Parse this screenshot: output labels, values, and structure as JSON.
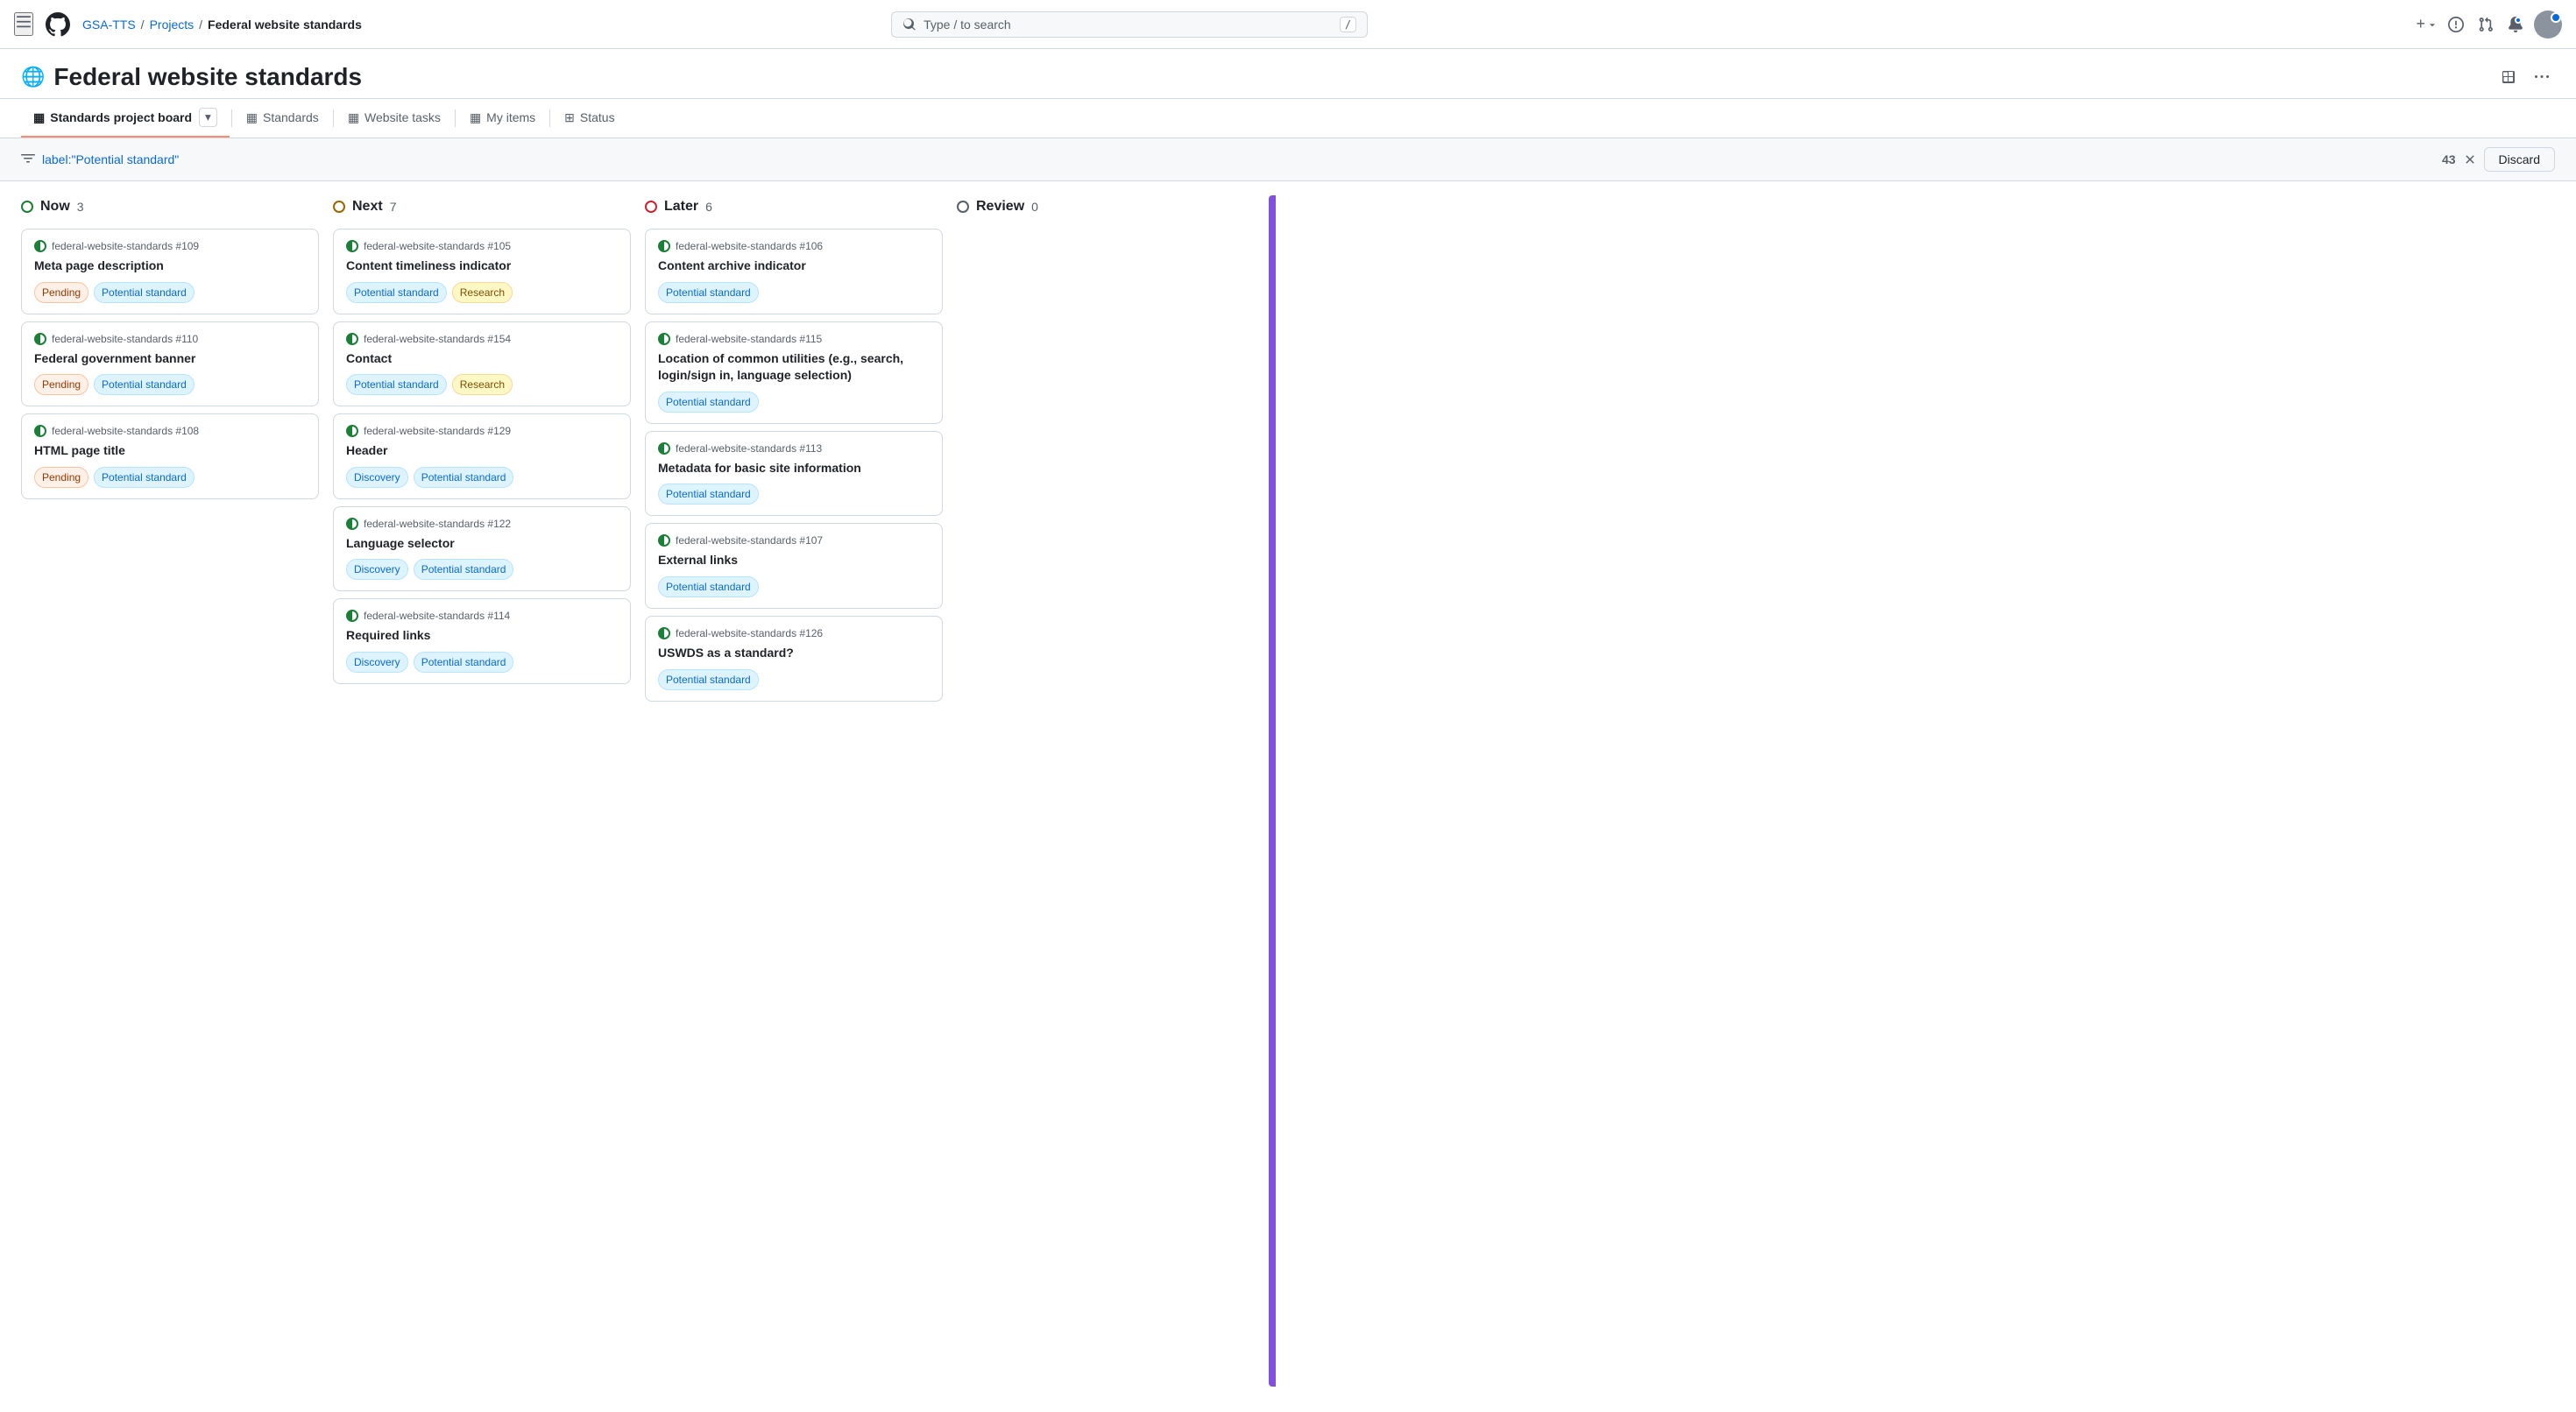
{
  "nav": {
    "hamburger": "☰",
    "org": "GSA-TTS",
    "sep1": "/",
    "projects": "Projects",
    "sep2": "/",
    "repo": "Federal website standards",
    "search_placeholder": "Type / to search",
    "search_kbd": "/",
    "plus_label": "+",
    "dropdown_icon": "▾"
  },
  "page": {
    "title": "Federal website standards",
    "globe": "🌐"
  },
  "tabs": [
    {
      "id": "standards-board",
      "icon": "▦",
      "label": "Standards project board",
      "active": true,
      "has_dropdown": true
    },
    {
      "id": "standards",
      "icon": "▦",
      "label": "Standards",
      "active": false
    },
    {
      "id": "website-tasks",
      "icon": "▦",
      "label": "Website tasks",
      "active": false
    },
    {
      "id": "my-items",
      "icon": "▦",
      "label": "My items",
      "active": false
    },
    {
      "id": "status",
      "icon": "⊞",
      "label": "Status",
      "active": false
    }
  ],
  "filter": {
    "icon": "⊟",
    "text": "label:\"Potential standard\"",
    "count": "43",
    "discard_label": "Discard"
  },
  "columns": [
    {
      "id": "now",
      "title": "Now",
      "count": "3",
      "status": "green",
      "cards": [
        {
          "id": "card-109",
          "meta": "federal-website-standards #109",
          "title": "Meta page description",
          "labels": [
            {
              "text": "Pending",
              "type": "pending"
            },
            {
              "text": "Potential standard",
              "type": "potential"
            }
          ]
        },
        {
          "id": "card-110",
          "meta": "federal-website-standards #110",
          "title": "Federal government banner",
          "labels": [
            {
              "text": "Pending",
              "type": "pending"
            },
            {
              "text": "Potential standard",
              "type": "potential"
            }
          ]
        },
        {
          "id": "card-108",
          "meta": "federal-website-standards #108",
          "title": "HTML page title",
          "labels": [
            {
              "text": "Pending",
              "type": "pending"
            },
            {
              "text": "Potential standard",
              "type": "potential"
            }
          ]
        }
      ]
    },
    {
      "id": "next",
      "title": "Next",
      "count": "7",
      "status": "yellow",
      "cards": [
        {
          "id": "card-105",
          "meta": "federal-website-standards #105",
          "title": "Content timeliness indicator",
          "labels": [
            {
              "text": "Potential standard",
              "type": "potential"
            },
            {
              "text": "Research",
              "type": "research"
            }
          ]
        },
        {
          "id": "card-154",
          "meta": "federal-website-standards #154",
          "title": "Contact",
          "labels": [
            {
              "text": "Potential standard",
              "type": "potential"
            },
            {
              "text": "Research",
              "type": "research"
            }
          ]
        },
        {
          "id": "card-129",
          "meta": "federal-website-standards #129",
          "title": "Header",
          "labels": [
            {
              "text": "Discovery",
              "type": "discovery"
            },
            {
              "text": "Potential standard",
              "type": "potential"
            }
          ]
        },
        {
          "id": "card-122",
          "meta": "federal-website-standards #122",
          "title": "Language selector",
          "labels": [
            {
              "text": "Discovery",
              "type": "discovery"
            },
            {
              "text": "Potential standard",
              "type": "potential"
            }
          ]
        },
        {
          "id": "card-114",
          "meta": "federal-website-standards #114",
          "title": "Required links",
          "labels": [
            {
              "text": "Discovery",
              "type": "discovery"
            },
            {
              "text": "Potential standard",
              "type": "potential"
            }
          ]
        }
      ]
    },
    {
      "id": "later",
      "title": "Later",
      "count": "6",
      "status": "red",
      "cards": [
        {
          "id": "card-106",
          "meta": "federal-website-standards #106",
          "title": "Content archive indicator",
          "labels": [
            {
              "text": "Potential standard",
              "type": "potential"
            }
          ]
        },
        {
          "id": "card-115",
          "meta": "federal-website-standards #115",
          "title": "Location of common utilities (e.g., search, login/sign in, language selection)",
          "labels": [
            {
              "text": "Potential standard",
              "type": "potential"
            }
          ]
        },
        {
          "id": "card-113",
          "meta": "federal-website-standards #113",
          "title": "Metadata for basic site information",
          "labels": [
            {
              "text": "Potential standard",
              "type": "potential"
            }
          ]
        },
        {
          "id": "card-107",
          "meta": "federal-website-standards #107",
          "title": "External links",
          "labels": [
            {
              "text": "Potential standard",
              "type": "potential"
            }
          ]
        },
        {
          "id": "card-126",
          "meta": "federal-website-standards #126",
          "title": "USWDS as a standard?",
          "labels": [
            {
              "text": "Potential standard",
              "type": "potential"
            }
          ]
        }
      ]
    },
    {
      "id": "review",
      "title": "Review",
      "count": "0",
      "status": "gray",
      "cards": []
    }
  ],
  "label_types": {
    "pending": "pending",
    "potential": "potential",
    "research": "research",
    "discovery": "discovery"
  }
}
